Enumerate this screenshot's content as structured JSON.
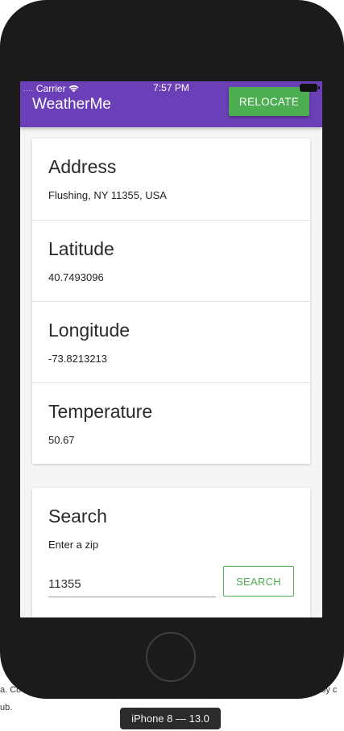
{
  "background_text": {
    "line1": "a. Co",
    "line1_right": "nt by c",
    "line2": "ub."
  },
  "status_bar": {
    "carrier": "Carrier",
    "time": "7:57 PM"
  },
  "app_bar": {
    "title": "WeatherMe",
    "relocate_label": "RELOCATE"
  },
  "info": [
    {
      "label": "Address",
      "value": "Flushing, NY 11355, USA"
    },
    {
      "label": "Latitude",
      "value": "40.7493096"
    },
    {
      "label": "Longitude",
      "value": "-73.8213213"
    },
    {
      "label": "Temperature",
      "value": "50.67"
    }
  ],
  "search": {
    "title": "Search",
    "hint": "Enter a zip",
    "zip_value": "11355",
    "button_label": "SEARCH"
  },
  "device_label": "iPhone 8 — 13.0",
  "colors": {
    "app_bar": "#6b3fb7",
    "accent_green": "#4cae50",
    "screen_bg": "#f5f5f5"
  }
}
